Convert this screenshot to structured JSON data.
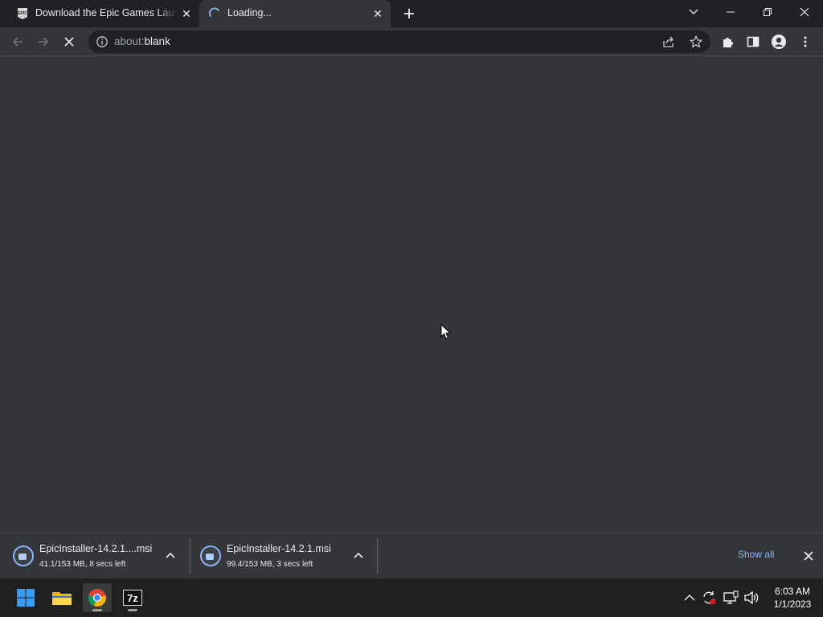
{
  "browser": {
    "tabs": [
      {
        "title": "Download the Epic Games Launcher",
        "favicon": "epic-games-icon",
        "active": false
      },
      {
        "title": "Loading...",
        "favicon": "loading-spinner-icon",
        "active": true
      }
    ],
    "new_tab_icon": "plus-icon",
    "window_controls": [
      "tab-search-icon",
      "minimize-icon",
      "restore-icon",
      "close-icon"
    ],
    "address_bar": {
      "url_dim": "about:",
      "url_main": "blank"
    }
  },
  "downloads": {
    "items": [
      {
        "name": "EpicInstaller-14.2.1....msi",
        "status": "41.1/153 MB, 8 secs left",
        "progress": 0.27
      },
      {
        "name": "EpicInstaller-14.2.1.msi",
        "status": "99.4/153 MB, 3 secs left",
        "progress": 0.65
      }
    ],
    "show_all_label": "Show all"
  },
  "taskbar": {
    "apps": [
      "windows-start-icon",
      "file-explorer-icon",
      "chrome-icon",
      "7zip-icon"
    ],
    "clock": {
      "time": "6:03 AM",
      "date": "1/1/2023"
    }
  },
  "colors": {
    "accent": "#8ab4f8",
    "chrome_dark": "#202124",
    "chrome_surface": "#35363a"
  }
}
